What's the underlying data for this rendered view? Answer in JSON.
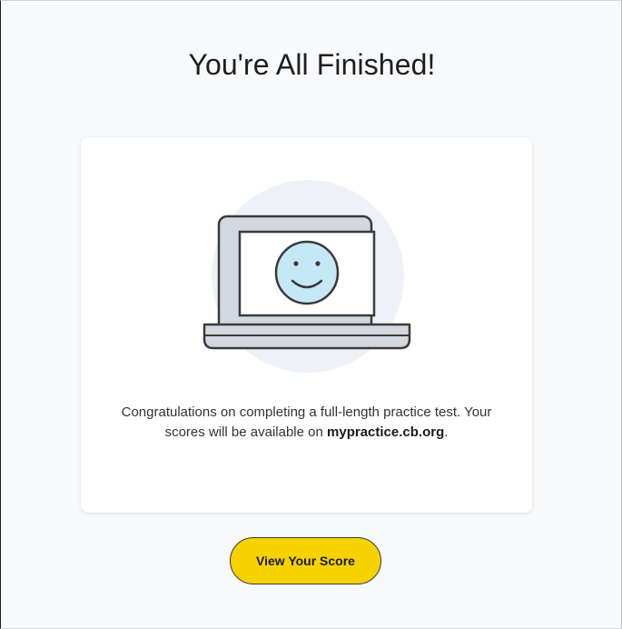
{
  "heading": "You're All Finished!",
  "message": {
    "text_before": "Congratulations on completing a full-length practice test. Your scores will be available on ",
    "link_text": "mypractice.cb.org",
    "text_after": "."
  },
  "button": {
    "label": "View Your Score"
  },
  "illustration": {
    "icon": "laptop-smiley-icon"
  },
  "colors": {
    "page_background": "#f8f9fb",
    "card_background": "#ffffff",
    "button_yellow": "#f5d200",
    "circle_background": "#eef1f8",
    "screen_face": "#c5e8f6"
  }
}
